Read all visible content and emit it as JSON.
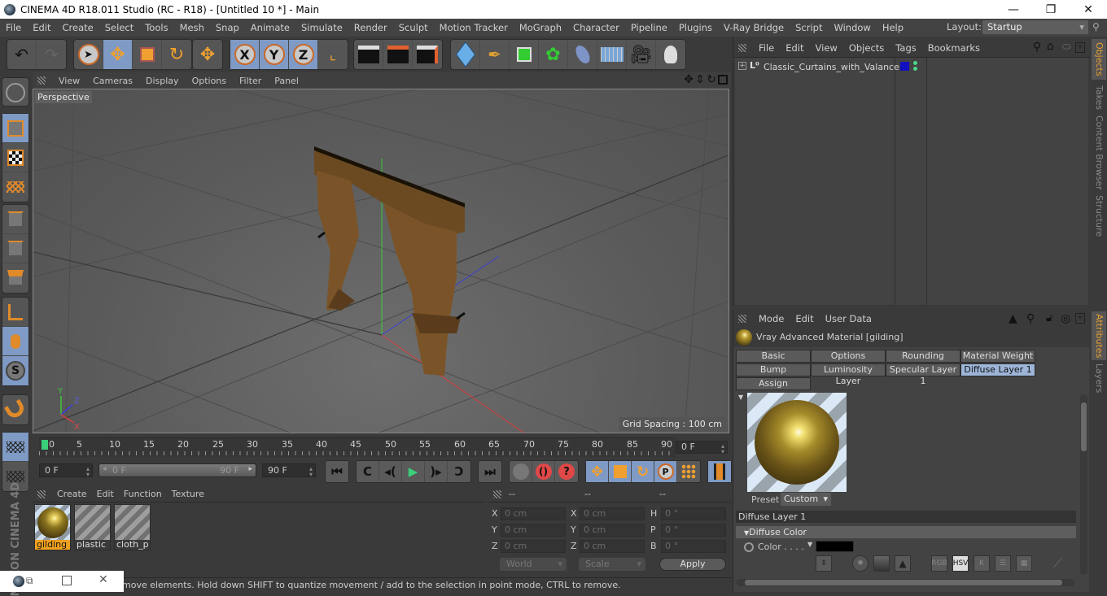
{
  "window": {
    "title": "CINEMA 4D R18.011 Studio (RC - R18) - [Untitled 10 *] - Main",
    "minimize": "—",
    "maximize": "❐",
    "close": "✕"
  },
  "menubar": {
    "items": [
      "File",
      "Edit",
      "Create",
      "Select",
      "Tools",
      "Mesh",
      "Snap",
      "Animate",
      "Simulate",
      "Render",
      "Sculpt",
      "Motion Tracker",
      "MoGraph",
      "Character",
      "Pipeline",
      "Plugins",
      "V-Ray Bridge",
      "Script",
      "Window",
      "Help"
    ],
    "layout_label": "Layout:",
    "layout_value": "Startup"
  },
  "toolbar": {
    "axis_x": "X",
    "axis_y": "Y",
    "axis_z": "Z"
  },
  "viewport": {
    "menu": [
      "View",
      "Cameras",
      "Display",
      "Options",
      "Filter",
      "Panel"
    ],
    "camera_label": "Perspective",
    "grid_spacing": "Grid Spacing : 100 cm",
    "axis_labels": {
      "x": "X",
      "y": "Y",
      "z": "Z"
    }
  },
  "timeline": {
    "ticks": [
      "0",
      "5",
      "10",
      "15",
      "20",
      "25",
      "30",
      "35",
      "40",
      "45",
      "50",
      "55",
      "60",
      "65",
      "70",
      "75",
      "80",
      "85",
      "90"
    ],
    "current_frame": "0 F",
    "start_field": "0 F",
    "range_start": "0 F",
    "range_end": "90 F",
    "end_field": "90 F"
  },
  "material_manager": {
    "menu": [
      "Create",
      "Edit",
      "Function",
      "Texture"
    ],
    "materials": [
      {
        "name": "gilding",
        "selected": true
      },
      {
        "name": "plastic",
        "selected": false
      },
      {
        "name": "cloth_p",
        "selected": false
      }
    ]
  },
  "coordinates": {
    "headers": [
      "--",
      "--",
      "--"
    ],
    "rows": [
      {
        "l1": "X",
        "v1": "0 cm",
        "l2": "X",
        "v2": "0 cm",
        "l3": "H",
        "v3": "0 °"
      },
      {
        "l1": "Y",
        "v1": "0 cm",
        "l2": "Y",
        "v2": "0 cm",
        "l3": "P",
        "v3": "0 °"
      },
      {
        "l1": "Z",
        "v1": "0 cm",
        "l2": "Z",
        "v2": "0 cm",
        "l3": "B",
        "v3": "0 °"
      }
    ],
    "space": "World",
    "mode": "Scale",
    "apply": "Apply"
  },
  "status": {
    "text": "move elements. Hold down SHIFT to quantize movement / add to the selection in point mode, CTRL to remove."
  },
  "object_manager": {
    "menu": [
      "File",
      "Edit",
      "View",
      "Objects",
      "Tags",
      "Bookmarks"
    ],
    "objects": [
      {
        "name": "Classic_Curtains_with_Valance",
        "layer_color": "#1010c0"
      }
    ]
  },
  "attribute_manager": {
    "menu": [
      "Mode",
      "Edit",
      "User Data"
    ],
    "title": "Vray Advanced Material [gilding]",
    "tabs_row1": [
      "Basic",
      "Options",
      "Rounding",
      "Material Weight"
    ],
    "tabs_row2": [
      "Bump",
      "Luminosity Layer",
      "Specular Layer 1",
      "Diffuse Layer 1"
    ],
    "tabs_row3": [
      "Assign"
    ],
    "active_tab": "Diffuse Layer 1",
    "preset_label": "Preset",
    "preset_value": "Custom",
    "section": "Diffuse Layer 1",
    "group": "Diffuse Color",
    "color_label": "Color . . . .",
    "color_value": "#000000",
    "color_modes": [
      "RGB",
      "HSV",
      "K"
    ],
    "active_color_mode": "HSV"
  },
  "side_tabs": {
    "top": [
      "Objects",
      "Takes",
      "Content Browser",
      "Structure"
    ],
    "bottom": [
      "Attributes",
      "Layers"
    ]
  },
  "brand": "MAXON CINEMA 4D"
}
